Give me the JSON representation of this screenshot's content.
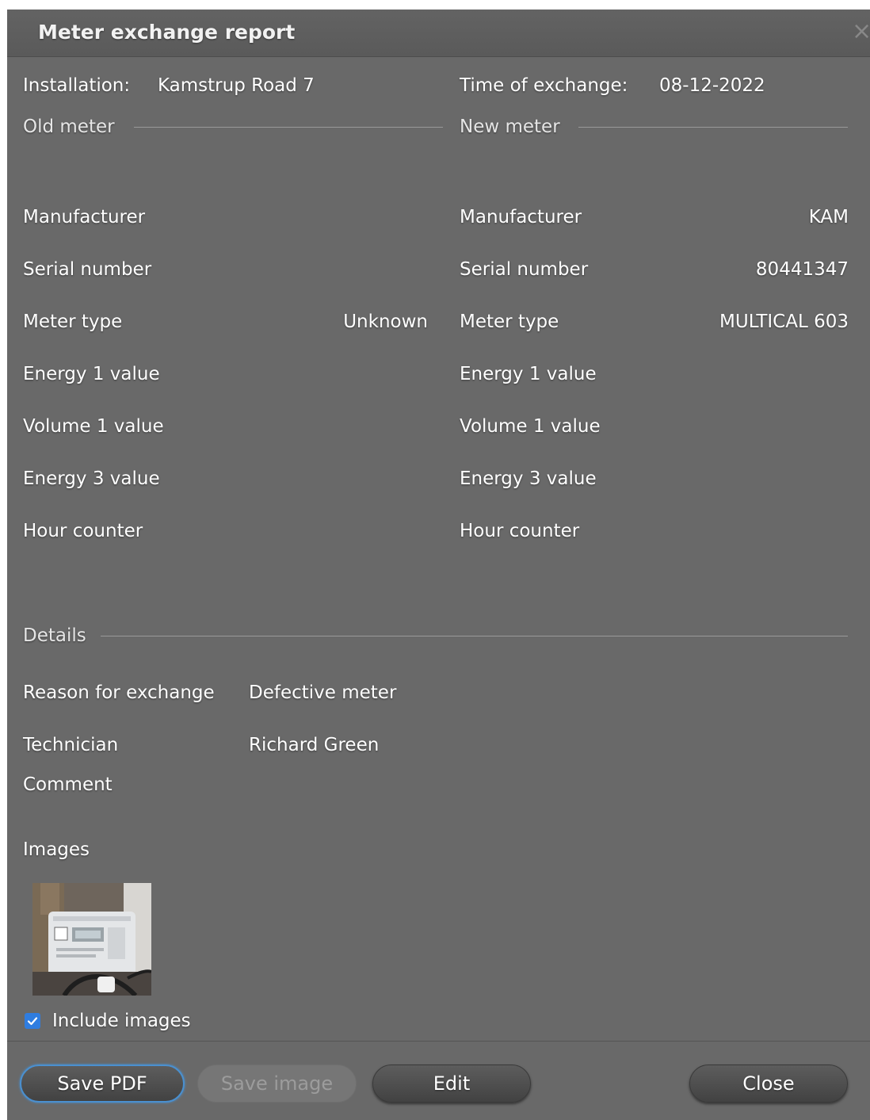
{
  "dialog": {
    "title": "Meter exchange report"
  },
  "header": {
    "installation_label": "Installation:",
    "installation_value": "Kamstrup Road 7",
    "time_label": "Time of exchange:",
    "time_value": "08-12-2022"
  },
  "old_meter": {
    "section_title": "Old meter",
    "rows": [
      {
        "label": "Manufacturer",
        "value": ""
      },
      {
        "label": "Serial number",
        "value": ""
      },
      {
        "label": "Meter type",
        "value": "Unknown"
      },
      {
        "label": "Energy 1 value",
        "value": ""
      },
      {
        "label": "Volume 1 value",
        "value": ""
      },
      {
        "label": "Energy 3 value",
        "value": ""
      },
      {
        "label": "Hour counter",
        "value": ""
      }
    ]
  },
  "new_meter": {
    "section_title": "New meter",
    "rows": [
      {
        "label": "Manufacturer",
        "value": "KAM"
      },
      {
        "label": "Serial number",
        "value": "80441347"
      },
      {
        "label": "Meter type",
        "value": "MULTICAL 603"
      },
      {
        "label": "Energy 1 value",
        "value": ""
      },
      {
        "label": "Volume 1 value",
        "value": ""
      },
      {
        "label": "Energy 3 value",
        "value": ""
      },
      {
        "label": "Hour counter",
        "value": ""
      }
    ]
  },
  "details": {
    "section_title": "Details",
    "reason_label": "Reason for exchange",
    "reason_value": "Defective meter",
    "technician_label": "Technician",
    "technician_value": "Richard Green",
    "comment_label": "Comment",
    "comment_value": ""
  },
  "images": {
    "label": "Images",
    "include_label": "Include images",
    "include_checked": true
  },
  "buttons": {
    "save_pdf": "Save PDF",
    "save_image": "Save image",
    "edit": "Edit",
    "close": "Close"
  },
  "colors": {
    "background": "#696969",
    "accent": "#2f7de0"
  }
}
